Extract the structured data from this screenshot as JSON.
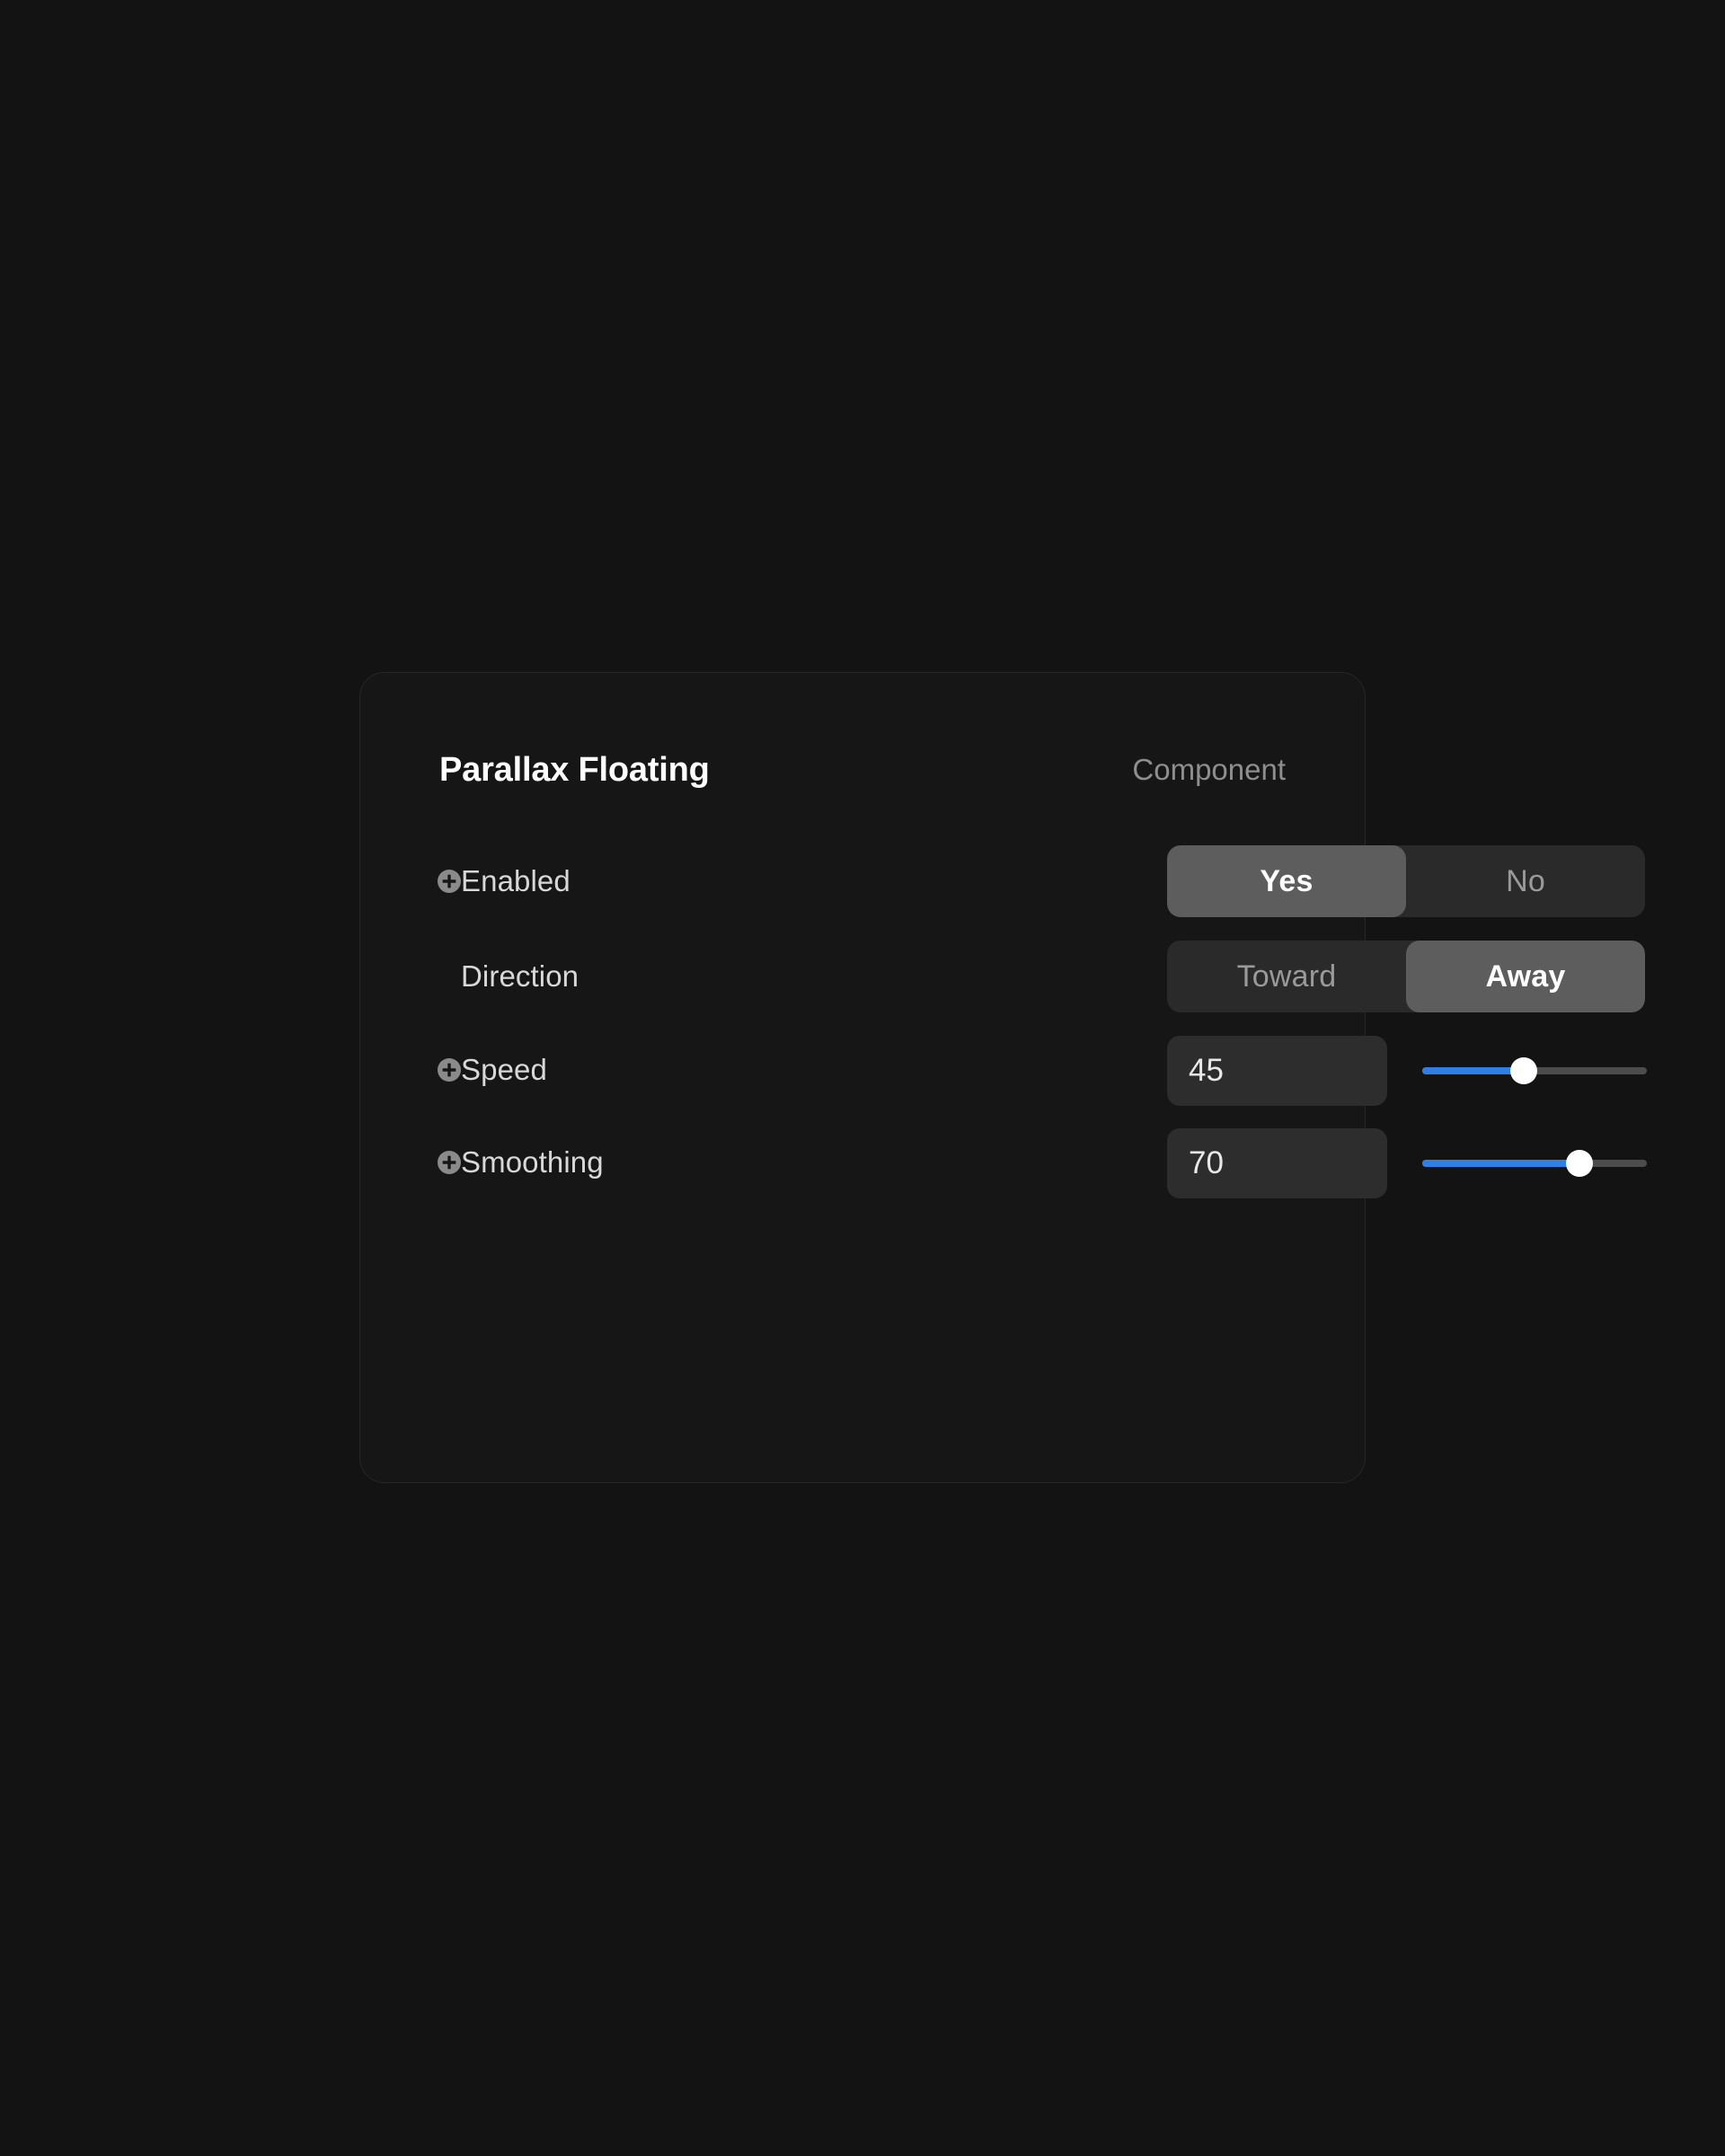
{
  "panel": {
    "title": "Parallax Floating",
    "kind_label": "Component",
    "rows": {
      "enabled": {
        "label": "Enabled",
        "icon": "plus-circle-icon",
        "control": "segmented",
        "options": [
          "Yes",
          "No"
        ],
        "selected": "Yes"
      },
      "direction": {
        "label": "Direction",
        "icon": null,
        "control": "segmented",
        "options": [
          "Toward",
          "Away"
        ],
        "selected": "Away"
      },
      "speed": {
        "label": "Speed",
        "icon": "plus-circle-icon",
        "control": "number-slider",
        "value": "45",
        "percent": 45
      },
      "smoothing": {
        "label": "Smoothing",
        "icon": "plus-circle-icon",
        "control": "number-slider",
        "value": "70",
        "percent": 70
      }
    }
  },
  "colors": {
    "page_background": "#131313",
    "panel_background": "#161616",
    "panel_border": "#272727",
    "segment_track": "#2a2a2a",
    "segment_active": "#5d5d5d",
    "field_background": "#2d2d2d",
    "slider_fill": "#2f7fe4",
    "slider_track": "#4c4c4c",
    "slider_thumb": "#ffffff",
    "text_primary": "#ffffff",
    "text_label": "#d8d8d8",
    "text_muted": "#8e8e8e",
    "icon_gray": "#8a8a8a"
  }
}
